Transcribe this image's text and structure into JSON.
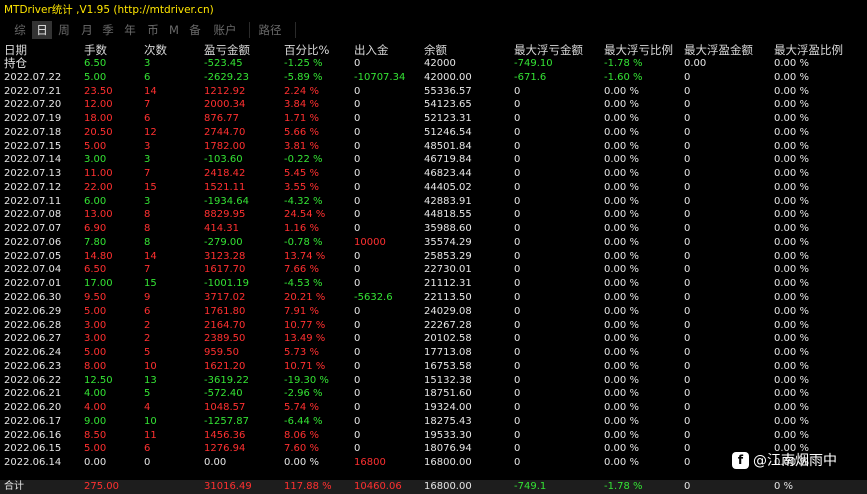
{
  "window": {
    "title": "MTDriver统计 ,V1.95 (http://mtdriver.cn)"
  },
  "tabs": [
    "综",
    "日",
    "周",
    "月",
    "季",
    "年",
    "币",
    "M",
    "备",
    "账户",
    "路径"
  ],
  "columns": [
    "日期",
    "手数",
    "次数",
    "盈亏金额",
    "百分比%",
    "出入金",
    "余额",
    "最大浮亏金额",
    "最大浮亏比例",
    "最大浮盈金额",
    "最大浮盈比例"
  ],
  "holding": {
    "date": "持仓",
    "lots": "6.50",
    "count": "3",
    "pnl": "-523.45",
    "pct": "-1.25 %",
    "flow": "0",
    "balance": "42000",
    "max_loss": "-749.10",
    "max_loss_pct": "-1.78 %",
    "max_gain": "0.00",
    "max_gain_pct": "0.00 %"
  },
  "rows": [
    {
      "date": "2022.07.22",
      "lots": "5.00",
      "count": "6",
      "pnl": "-2629.23",
      "pct": "-5.89 %",
      "flow": "-10707.34",
      "balance": "42000.00",
      "max_loss": "-671.6",
      "max_loss_pct": "-1.60 %",
      "max_gain": "0",
      "max_gain_pct": "0.00 %"
    },
    {
      "date": "2022.07.21",
      "lots": "23.50",
      "count": "14",
      "pnl": "1212.92",
      "pct": "2.24 %",
      "flow": "0",
      "balance": "55336.57",
      "max_loss": "0",
      "max_loss_pct": "0.00 %",
      "max_gain": "0",
      "max_gain_pct": "0.00 %"
    },
    {
      "date": "2022.07.20",
      "lots": "12.00",
      "count": "7",
      "pnl": "2000.34",
      "pct": "3.84 %",
      "flow": "0",
      "balance": "54123.65",
      "max_loss": "0",
      "max_loss_pct": "0.00 %",
      "max_gain": "0",
      "max_gain_pct": "0.00 %"
    },
    {
      "date": "2022.07.19",
      "lots": "18.00",
      "count": "6",
      "pnl": "876.77",
      "pct": "1.71 %",
      "flow": "0",
      "balance": "52123.31",
      "max_loss": "0",
      "max_loss_pct": "0.00 %",
      "max_gain": "0",
      "max_gain_pct": "0.00 %"
    },
    {
      "date": "2022.07.18",
      "lots": "20.50",
      "count": "12",
      "pnl": "2744.70",
      "pct": "5.66 %",
      "flow": "0",
      "balance": "51246.54",
      "max_loss": "0",
      "max_loss_pct": "0.00 %",
      "max_gain": "0",
      "max_gain_pct": "0.00 %"
    },
    {
      "date": "2022.07.15",
      "lots": "5.00",
      "count": "3",
      "pnl": "1782.00",
      "pct": "3.81 %",
      "flow": "0",
      "balance": "48501.84",
      "max_loss": "0",
      "max_loss_pct": "0.00 %",
      "max_gain": "0",
      "max_gain_pct": "0.00 %"
    },
    {
      "date": "2022.07.14",
      "lots": "3.00",
      "count": "3",
      "pnl": "-103.60",
      "pct": "-0.22 %",
      "flow": "0",
      "balance": "46719.84",
      "max_loss": "0",
      "max_loss_pct": "0.00 %",
      "max_gain": "0",
      "max_gain_pct": "0.00 %"
    },
    {
      "date": "2022.07.13",
      "lots": "11.00",
      "count": "7",
      "pnl": "2418.42",
      "pct": "5.45 %",
      "flow": "0",
      "balance": "46823.44",
      "max_loss": "0",
      "max_loss_pct": "0.00 %",
      "max_gain": "0",
      "max_gain_pct": "0.00 %"
    },
    {
      "date": "2022.07.12",
      "lots": "22.00",
      "count": "15",
      "pnl": "1521.11",
      "pct": "3.55 %",
      "flow": "0",
      "balance": "44405.02",
      "max_loss": "0",
      "max_loss_pct": "0.00 %",
      "max_gain": "0",
      "max_gain_pct": "0.00 %"
    },
    {
      "date": "2022.07.11",
      "lots": "6.00",
      "count": "3",
      "pnl": "-1934.64",
      "pct": "-4.32 %",
      "flow": "0",
      "balance": "42883.91",
      "max_loss": "0",
      "max_loss_pct": "0.00 %",
      "max_gain": "0",
      "max_gain_pct": "0.00 %"
    },
    {
      "date": "2022.07.08",
      "lots": "13.00",
      "count": "8",
      "pnl": "8829.95",
      "pct": "24.54 %",
      "flow": "0",
      "balance": "44818.55",
      "max_loss": "0",
      "max_loss_pct": "0.00 %",
      "max_gain": "0",
      "max_gain_pct": "0.00 %"
    },
    {
      "date": "2022.07.07",
      "lots": "6.90",
      "count": "8",
      "pnl": "414.31",
      "pct": "1.16 %",
      "flow": "0",
      "balance": "35988.60",
      "max_loss": "0",
      "max_loss_pct": "0.00 %",
      "max_gain": "0",
      "max_gain_pct": "0.00 %"
    },
    {
      "date": "2022.07.06",
      "lots": "7.80",
      "count": "8",
      "pnl": "-279.00",
      "pct": "-0.78 %",
      "flow": "10000",
      "balance": "35574.29",
      "max_loss": "0",
      "max_loss_pct": "0.00 %",
      "max_gain": "0",
      "max_gain_pct": "0.00 %"
    },
    {
      "date": "2022.07.05",
      "lots": "14.80",
      "count": "14",
      "pnl": "3123.28",
      "pct": "13.74 %",
      "flow": "0",
      "balance": "25853.29",
      "max_loss": "0",
      "max_loss_pct": "0.00 %",
      "max_gain": "0",
      "max_gain_pct": "0.00 %"
    },
    {
      "date": "2022.07.04",
      "lots": "6.50",
      "count": "7",
      "pnl": "1617.70",
      "pct": "7.66 %",
      "flow": "0",
      "balance": "22730.01",
      "max_loss": "0",
      "max_loss_pct": "0.00 %",
      "max_gain": "0",
      "max_gain_pct": "0.00 %"
    },
    {
      "date": "2022.07.01",
      "lots": "17.00",
      "count": "15",
      "pnl": "-1001.19",
      "pct": "-4.53 %",
      "flow": "0",
      "balance": "21112.31",
      "max_loss": "0",
      "max_loss_pct": "0.00 %",
      "max_gain": "0",
      "max_gain_pct": "0.00 %"
    },
    {
      "date": "2022.06.30",
      "lots": "9.50",
      "count": "9",
      "pnl": "3717.02",
      "pct": "20.21 %",
      "flow": "-5632.6",
      "balance": "22113.50",
      "max_loss": "0",
      "max_loss_pct": "0.00 %",
      "max_gain": "0",
      "max_gain_pct": "0.00 %"
    },
    {
      "date": "2022.06.29",
      "lots": "5.00",
      "count": "6",
      "pnl": "1761.80",
      "pct": "7.91 %",
      "flow": "0",
      "balance": "24029.08",
      "max_loss": "0",
      "max_loss_pct": "0.00 %",
      "max_gain": "0",
      "max_gain_pct": "0.00 %"
    },
    {
      "date": "2022.06.28",
      "lots": "3.00",
      "count": "2",
      "pnl": "2164.70",
      "pct": "10.77 %",
      "flow": "0",
      "balance": "22267.28",
      "max_loss": "0",
      "max_loss_pct": "0.00 %",
      "max_gain": "0",
      "max_gain_pct": "0.00 %"
    },
    {
      "date": "2022.06.27",
      "lots": "3.00",
      "count": "2",
      "pnl": "2389.50",
      "pct": "13.49 %",
      "flow": "0",
      "balance": "20102.58",
      "max_loss": "0",
      "max_loss_pct": "0.00 %",
      "max_gain": "0",
      "max_gain_pct": "0.00 %"
    },
    {
      "date": "2022.06.24",
      "lots": "5.00",
      "count": "5",
      "pnl": "959.50",
      "pct": "5.73 %",
      "flow": "0",
      "balance": "17713.08",
      "max_loss": "0",
      "max_loss_pct": "0.00 %",
      "max_gain": "0",
      "max_gain_pct": "0.00 %"
    },
    {
      "date": "2022.06.23",
      "lots": "8.00",
      "count": "10",
      "pnl": "1621.20",
      "pct": "10.71 %",
      "flow": "0",
      "balance": "16753.58",
      "max_loss": "0",
      "max_loss_pct": "0.00 %",
      "max_gain": "0",
      "max_gain_pct": "0.00 %"
    },
    {
      "date": "2022.06.22",
      "lots": "12.50",
      "count": "13",
      "pnl": "-3619.22",
      "pct": "-19.30 %",
      "flow": "0",
      "balance": "15132.38",
      "max_loss": "0",
      "max_loss_pct": "0.00 %",
      "max_gain": "0",
      "max_gain_pct": "0.00 %"
    },
    {
      "date": "2022.06.21",
      "lots": "4.00",
      "count": "5",
      "pnl": "-572.40",
      "pct": "-2.96 %",
      "flow": "0",
      "balance": "18751.60",
      "max_loss": "0",
      "max_loss_pct": "0.00 %",
      "max_gain": "0",
      "max_gain_pct": "0.00 %"
    },
    {
      "date": "2022.06.20",
      "lots": "4.00",
      "count": "4",
      "pnl": "1048.57",
      "pct": "5.74 %",
      "flow": "0",
      "balance": "19324.00",
      "max_loss": "0",
      "max_loss_pct": "0.00 %",
      "max_gain": "0",
      "max_gain_pct": "0.00 %"
    },
    {
      "date": "2022.06.17",
      "lots": "9.00",
      "count": "10",
      "pnl": "-1257.87",
      "pct": "-6.44 %",
      "flow": "0",
      "balance": "18275.43",
      "max_loss": "0",
      "max_loss_pct": "0.00 %",
      "max_gain": "0",
      "max_gain_pct": "0.00 %"
    },
    {
      "date": "2022.06.16",
      "lots": "8.50",
      "count": "11",
      "pnl": "1456.36",
      "pct": "8.06 %",
      "flow": "0",
      "balance": "19533.30",
      "max_loss": "0",
      "max_loss_pct": "0.00 %",
      "max_gain": "0",
      "max_gain_pct": "0.00 %"
    },
    {
      "date": "2022.06.15",
      "lots": "5.00",
      "count": "6",
      "pnl": "1276.94",
      "pct": "7.60 %",
      "flow": "0",
      "balance": "18076.94",
      "max_loss": "0",
      "max_loss_pct": "0.00 %",
      "max_gain": "0",
      "max_gain_pct": "0.00 %"
    },
    {
      "date": "2022.06.14",
      "lots": "0.00",
      "count": "0",
      "pnl": "0.00",
      "pct": "0.00 %",
      "flow": "16800",
      "balance": "16800.00",
      "max_loss": "0",
      "max_loss_pct": "0.00 %",
      "max_gain": "0",
      "max_gain_pct": "0.00 %"
    }
  ],
  "total": {
    "date": "合计",
    "lots": "275.00",
    "count": "",
    "pnl": "31016.49",
    "pct": "117.88 %",
    "flow": "10460.06",
    "balance": "16800.00",
    "max_loss": "-749.1",
    "max_loss_pct": "-1.78 %",
    "max_gain": "0",
    "max_gain_pct": "0 %"
  },
  "watermark": {
    "icon": "f",
    "text": "@江南烟雨中"
  },
  "colors": {
    "background": "#000000",
    "title": "#ffe600",
    "profit": "#ff3030",
    "loss": "#34e334",
    "neutral": "#e6e6e6",
    "active_tab_bg": "#333333"
  }
}
